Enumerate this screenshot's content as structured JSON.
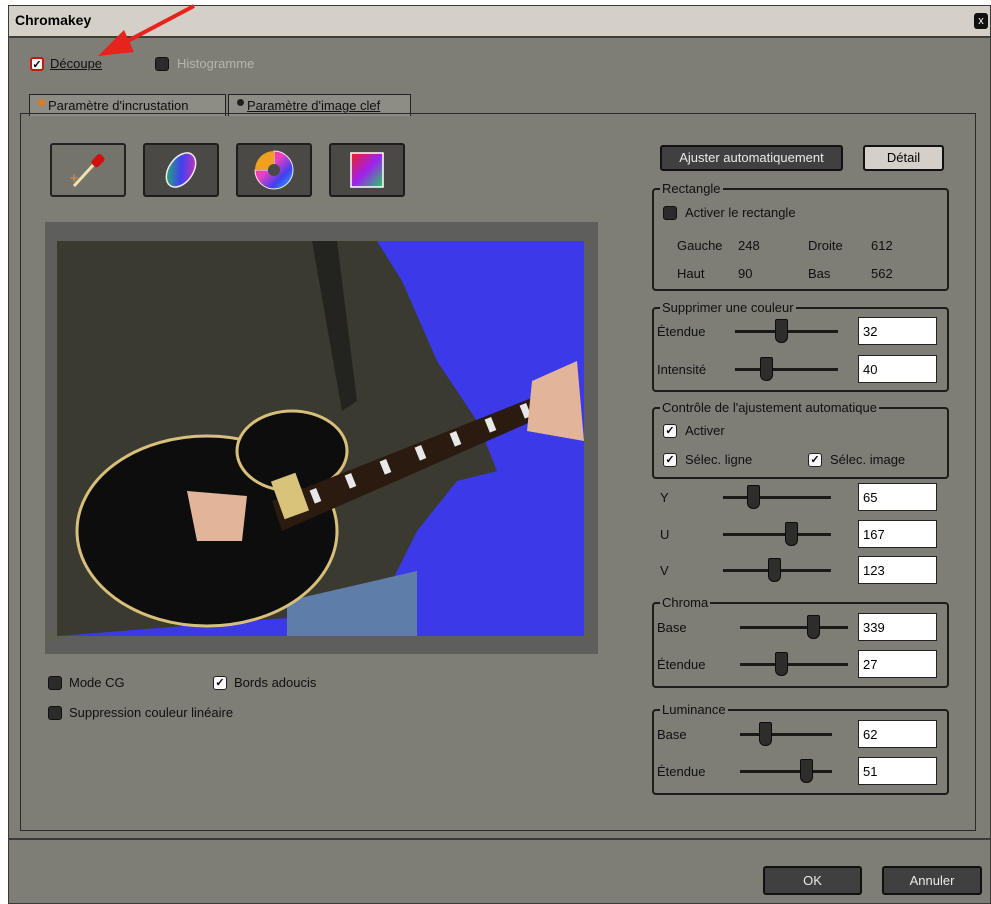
{
  "window": {
    "title": "Chromakey",
    "close_glyph": "x"
  },
  "top_options": {
    "decoupe": {
      "label": "Découpe",
      "checked": true
    },
    "histogramme": {
      "label": "Histogramme",
      "checked": false
    }
  },
  "tabs": [
    {
      "label": "Paramètre d'incrustation",
      "active": true,
      "dot_color": "#e07a20"
    },
    {
      "label": "Paramètre d'image clef",
      "active": false,
      "dot_color": "#202020"
    }
  ],
  "tools": [
    {
      "icon": "eyedropper-icon",
      "active": true
    },
    {
      "icon": "color-ellipse-icon",
      "active": false
    },
    {
      "icon": "color-wheel-icon",
      "active": false
    },
    {
      "icon": "color-square-icon",
      "active": false
    }
  ],
  "bottom_options": {
    "mode_cg": {
      "label": "Mode CG",
      "checked": false
    },
    "bords_adoucis": {
      "label": "Bords adoucis",
      "checked": true
    },
    "suppression": {
      "label": "Suppression couleur linéaire",
      "checked": false
    }
  },
  "buttons": {
    "ajuster": "Ajuster automatiquement",
    "detail": "Détail",
    "ok": "OK",
    "annuler": "Annuler"
  },
  "rectangle": {
    "title": "Rectangle",
    "activer": {
      "label": "Activer le rectangle",
      "checked": false
    },
    "gauche_label": "Gauche",
    "gauche_value": "248",
    "droite_label": "Droite",
    "droite_value": "612",
    "haut_label": "Haut",
    "haut_value": "90",
    "bas_label": "Bas",
    "bas_value": "562"
  },
  "supprimer": {
    "title": "Supprimer une couleur",
    "etendue": {
      "label": "Étendue",
      "value": "32",
      "level": 0.45
    },
    "intensite": {
      "label": "Intensité",
      "value": "40",
      "level": 0.3
    }
  },
  "controle": {
    "title": "Contrôle de l'ajustement automatique",
    "activer": {
      "label": "Activer",
      "checked": true
    },
    "selec_ligne": {
      "label": "Sélec. ligne",
      "checked": true
    },
    "selec_image": {
      "label": "Sélec. image",
      "checked": true
    }
  },
  "yuv": [
    {
      "label": "Y",
      "value": "65",
      "level": 0.28
    },
    {
      "label": "U",
      "value": "167",
      "level": 0.63
    },
    {
      "label": "V",
      "value": "123",
      "level": 0.47
    }
  ],
  "chroma": {
    "title": "Chroma",
    "base": {
      "label": "Base",
      "value": "339",
      "level": 0.68
    },
    "etendue": {
      "label": "Étendue",
      "value": "27",
      "level": 0.38
    }
  },
  "luminance": {
    "title": "Luminance",
    "base": {
      "label": "Base",
      "value": "62",
      "level": 0.27
    },
    "etendue": {
      "label": "Étendue",
      "value": "51",
      "level": 0.72
    }
  },
  "colors": {
    "accent_arrow": "#e8221c",
    "key_background": "#3b39e8"
  }
}
